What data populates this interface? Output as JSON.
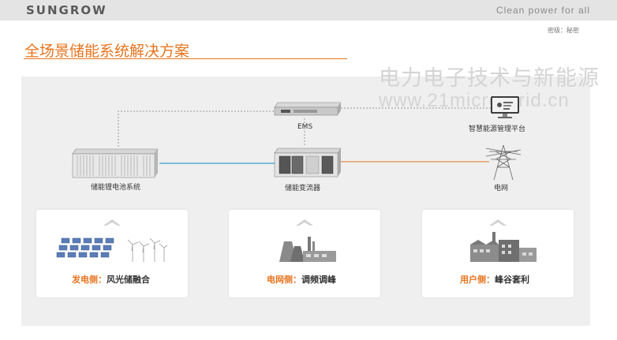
{
  "header": {
    "logo": "SUNGROW",
    "slogan": "Clean power for all",
    "confidentiality": "密级：秘密"
  },
  "title": "全场景储能系统解决方案",
  "watermark": {
    "line1": "电力电子技术与新能源",
    "line2": "www.21micro-grid.cn"
  },
  "diagram": {
    "ems": "EMS",
    "platform": "智慧能源管理平台",
    "battery": "储能锂电池系统",
    "pcs": "储能变流器",
    "grid": "电网"
  },
  "cards": [
    {
      "highlight": "发电侧：",
      "text": "风光储融合",
      "icon": "solar-wind-icon"
    },
    {
      "highlight": "电网侧：",
      "text": "调频调峰",
      "icon": "power-plant-icon"
    },
    {
      "highlight": "用户侧：",
      "text": "峰谷套利",
      "icon": "factory-icon"
    }
  ],
  "colors": {
    "accent": "#e8741e",
    "link_blue": "#5aa8d8",
    "panel_bg": "#efefef"
  }
}
